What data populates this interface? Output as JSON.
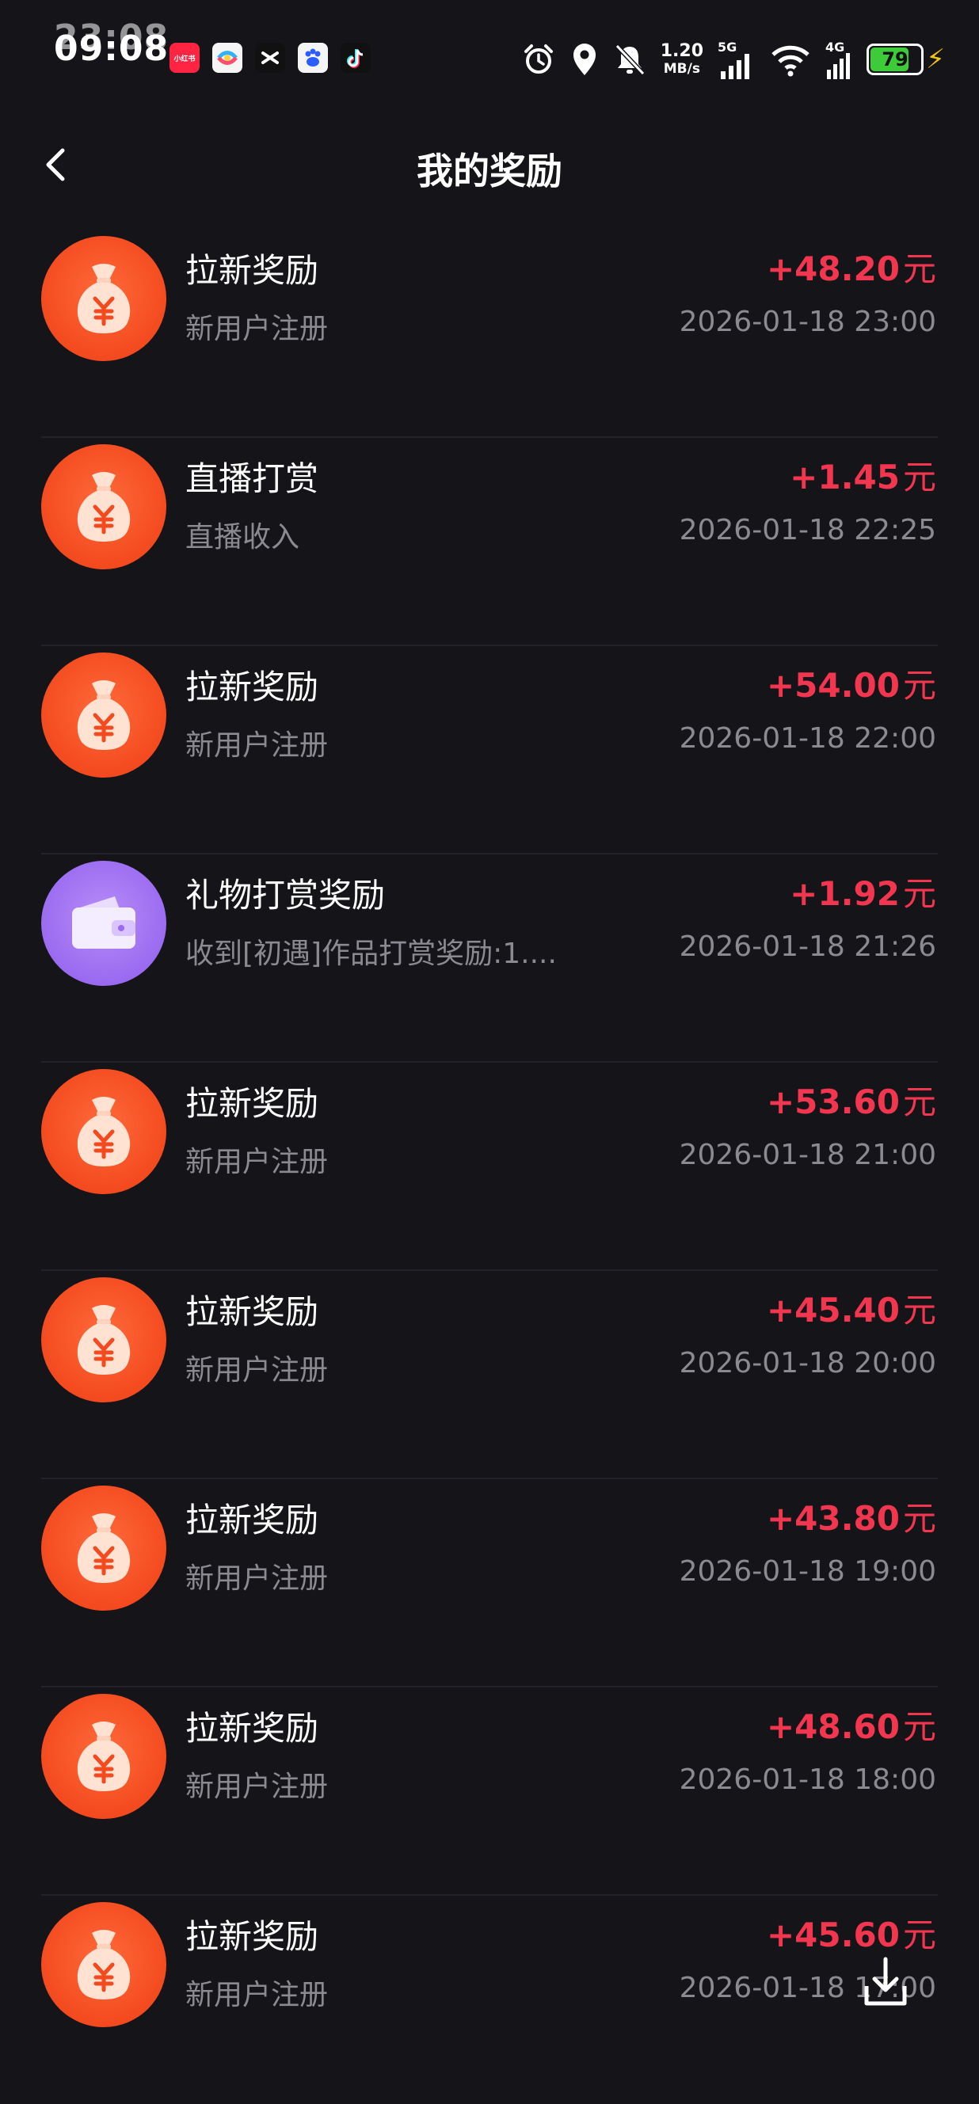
{
  "status_bar": {
    "time": "09:08",
    "time_ghost": "23:08",
    "net_speed_value": "1.20",
    "net_speed_unit": "MB/s",
    "network_label_5g": "5G",
    "network_label_4g": "4G",
    "battery": "79",
    "app_icons": [
      {
        "name": "xiaohongshu-app-icon",
        "label": "小红书",
        "color": "#ff2442"
      },
      {
        "name": "colorful-app-icon",
        "label": "",
        "color": "#f5f5f5"
      },
      {
        "name": "capcut-app-icon",
        "label": "",
        "color": "#111111"
      },
      {
        "name": "baidu-app-icon",
        "label": "",
        "color": "#f5f5f5"
      },
      {
        "name": "tiktok-app-icon",
        "label": "",
        "color": "#111111"
      }
    ]
  },
  "header": {
    "title": "我的奖励"
  },
  "colors": {
    "background": "#151419",
    "amount": "#f3364f",
    "subtext": "#8b8a91",
    "money_icon": "#f34a1f",
    "wallet_icon": "#9a6bf0"
  },
  "currency_unit": "元",
  "rewards": [
    {
      "icon": "money-bag-icon",
      "title": "拉新奖励",
      "subtitle": "新用户注册",
      "amount": "+48.20",
      "time": "2026-01-18 23:00"
    },
    {
      "icon": "money-bag-icon",
      "title": "直播打赏",
      "subtitle": "直播收入",
      "amount": "+1.45",
      "time": "2026-01-18 22:25"
    },
    {
      "icon": "money-bag-icon",
      "title": "拉新奖励",
      "subtitle": "新用户注册",
      "amount": "+54.00",
      "time": "2026-01-18 22:00"
    },
    {
      "icon": "wallet-icon",
      "title": "礼物打赏奖励",
      "subtitle": "收到[初遇]作品打赏奖励:1....",
      "amount": "+1.92",
      "time": "2026-01-18 21:26"
    },
    {
      "icon": "money-bag-icon",
      "title": "拉新奖励",
      "subtitle": "新用户注册",
      "amount": "+53.60",
      "time": "2026-01-18 21:00"
    },
    {
      "icon": "money-bag-icon",
      "title": "拉新奖励",
      "subtitle": "新用户注册",
      "amount": "+45.40",
      "time": "2026-01-18 20:00"
    },
    {
      "icon": "money-bag-icon",
      "title": "拉新奖励",
      "subtitle": "新用户注册",
      "amount": "+43.80",
      "time": "2026-01-18 19:00"
    },
    {
      "icon": "money-bag-icon",
      "title": "拉新奖励",
      "subtitle": "新用户注册",
      "amount": "+48.60",
      "time": "2026-01-18 18:00"
    },
    {
      "icon": "money-bag-icon",
      "title": "拉新奖励",
      "subtitle": "新用户注册",
      "amount": "+45.60",
      "time": "2026-01-18 17:00"
    }
  ]
}
